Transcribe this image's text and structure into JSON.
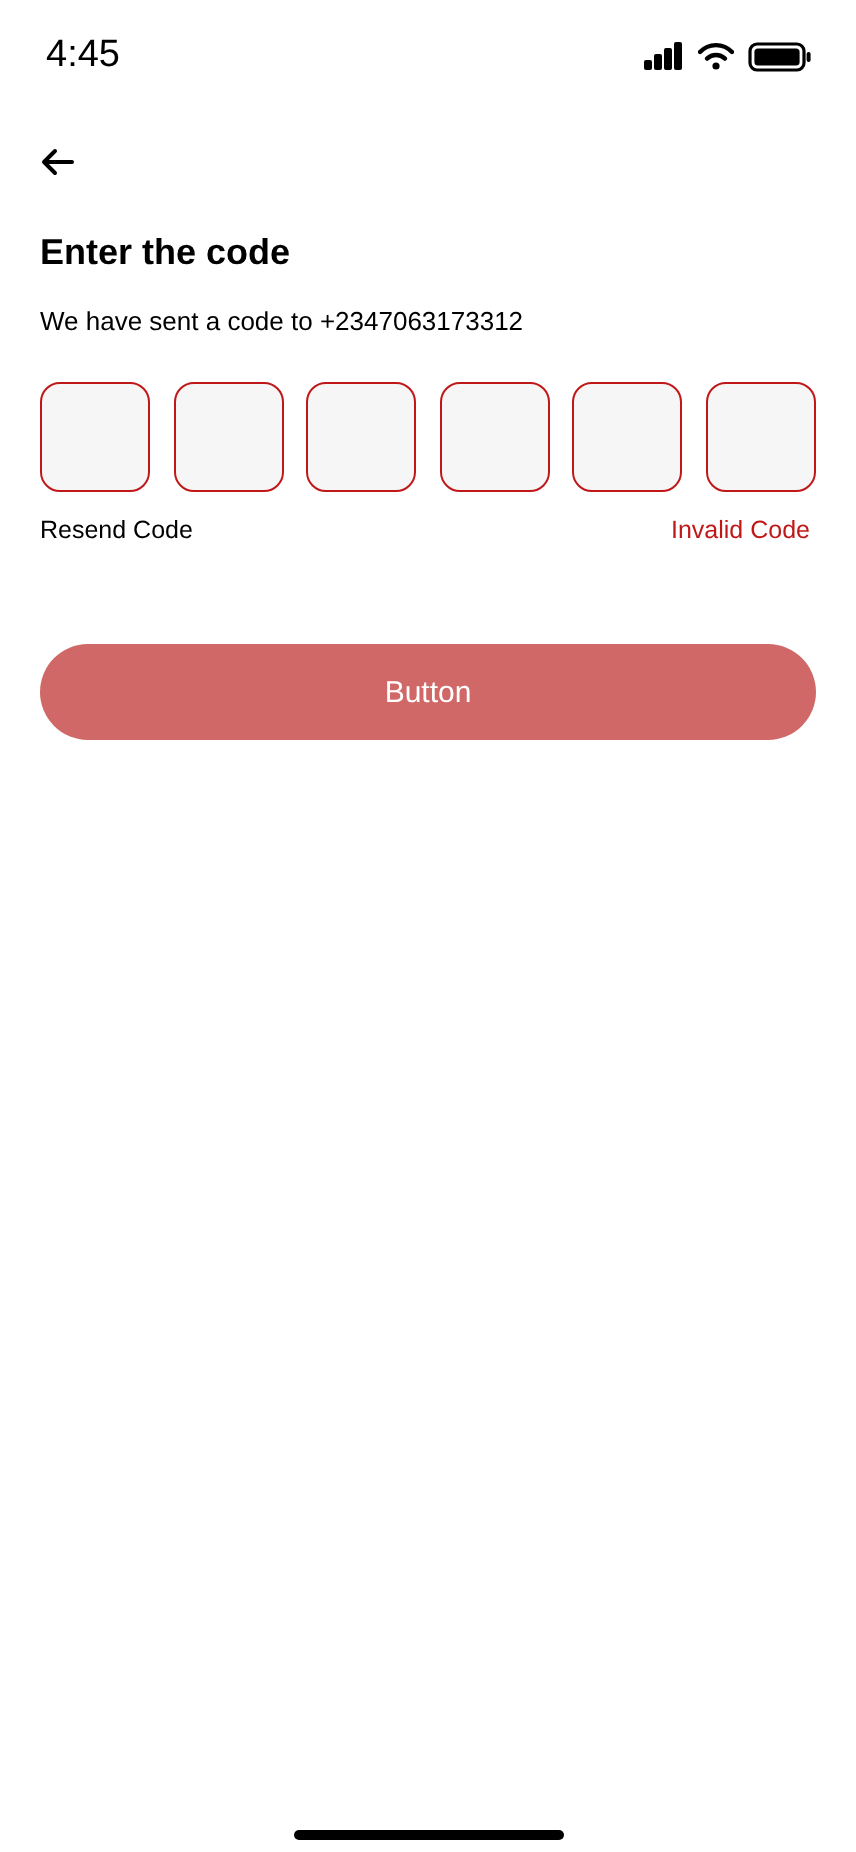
{
  "status_bar": {
    "time": "4:45"
  },
  "title": "Enter the code",
  "subtitle": "We have sent a code to +2347063173312",
  "code_boxes": [
    {
      "error": true
    },
    {
      "error": true
    },
    {
      "error": true
    },
    {
      "error": true
    },
    {
      "error": true
    },
    {
      "error": true
    }
  ],
  "resend_link": "Resend Code",
  "error_message": "Invalid Code",
  "button": {
    "label": "Button",
    "disabled": true
  }
}
